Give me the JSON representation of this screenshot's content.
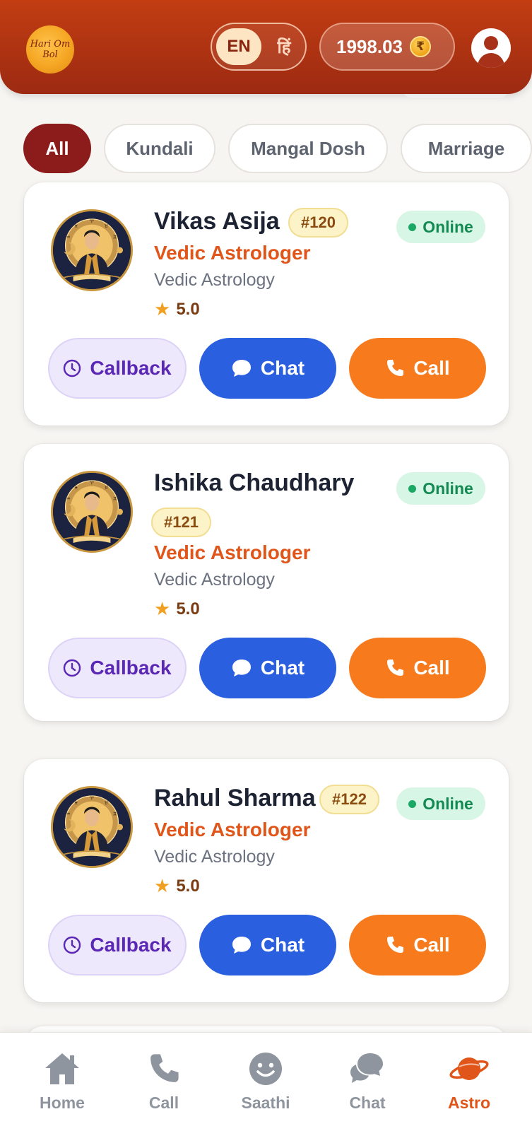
{
  "header": {
    "logo_lines": [
      "Hari Om",
      "Bol"
    ],
    "lang_en": "EN",
    "lang_hi": "हिं",
    "wallet_balance": "1998.03",
    "currency_symbol": "₹"
  },
  "filters": [
    {
      "label": "All",
      "active": true
    },
    {
      "label": "Kundali",
      "active": false
    },
    {
      "label": "Mangal Dosh",
      "active": false
    },
    {
      "label": "Marriage",
      "active": false
    }
  ],
  "astrologers": [
    {
      "name": "Vikas Asija",
      "id": "#120",
      "status": "Online",
      "role": "Vedic Astrologer",
      "specialty": "Vedic Astrology",
      "rating": "5.0"
    },
    {
      "name": "Ishika Chaudhary",
      "id": "#121",
      "status": "Online",
      "role": "Vedic Astrologer",
      "specialty": "Vedic Astrology",
      "rating": "5.0"
    },
    {
      "name": "Rahul Sharma",
      "id": "#122",
      "status": "Online",
      "role": "Vedic Astrologer",
      "specialty": "Vedic Astrology",
      "rating": "5.0"
    }
  ],
  "actions": {
    "callback_label": "Callback",
    "chat_label": "Chat",
    "call_label": "Call"
  },
  "nav": [
    {
      "label": "Home",
      "icon": "home-icon",
      "active": false
    },
    {
      "label": "Call",
      "icon": "phone-icon",
      "active": false
    },
    {
      "label": "Saathi",
      "icon": "smiley-icon",
      "active": false
    },
    {
      "label": "Chat",
      "icon": "chat-bubbles-icon",
      "active": false
    },
    {
      "label": "Astro",
      "icon": "planet-icon",
      "active": true
    }
  ],
  "colors": {
    "header_red": "#b8361a",
    "active_chip": "#8c1b1b",
    "chat_blue": "#2a5fe0",
    "call_orange": "#f77a1c",
    "callback_purple": "#5b27b5",
    "online_green": "#138a52",
    "astro_active": "#e0561a"
  }
}
